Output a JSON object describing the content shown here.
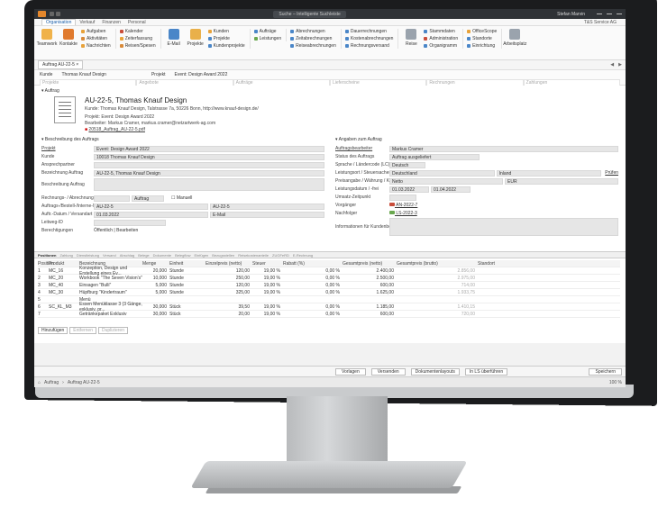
{
  "window": {
    "search": "Suche – Intelligente Suchleiste",
    "user": "Stefan Marvin",
    "company": "T&S Service AG"
  },
  "menu_tabs": [
    "Organisation",
    "Verkauf",
    "Finanzen",
    "Personal"
  ],
  "ribbon": {
    "big1": "Teamwork",
    "big2": "Kontakte",
    "big3": "E-Mail",
    "big4": "Projekte",
    "big5": "Reise",
    "big6": "Arbeitsplatz",
    "g1": [
      "Aufgaben",
      "Aktivitäten",
      "Nachrichten"
    ],
    "g2": [
      "Kalender",
      "Zeiterfassung",
      "Reisen/Spesen"
    ],
    "g3": [
      "Kunden",
      "Projekte",
      "Kundenprojekte"
    ],
    "g4": [
      "Aufträge",
      "Leistungen"
    ],
    "g5": [
      "Abrechnungen",
      "Zeitabrechnungen",
      "Reiseabrechnungen"
    ],
    "g6": [
      "Dauerrechnungen",
      "Kostenabrechnungen",
      "Rechnungsversand"
    ],
    "g7": [
      "Stammdaten",
      "Administration",
      "Organigramm"
    ],
    "g8": [
      "OfficeScope",
      "Standorte",
      "Einrichtung"
    ]
  },
  "nav": {
    "tab": "Auftrag AU-22-5",
    "close": "×",
    "back": "◀",
    "fwd": "▶"
  },
  "filter": {
    "kunde_label": "Kunde",
    "kunde": "Thomas Knauf Design",
    "projekt_label": "Projekt",
    "projekt": "Event: Design Award 2022",
    "cols": [
      "Projekte",
      "Angebote",
      "Aufträge",
      "Lieferscheine",
      "Rechnungen",
      "Zahlungen"
    ]
  },
  "section_auftrag": "Auftrag",
  "header": {
    "title": "AU-22-5, Thomas Knauf Design",
    "kunde": "Kunde: Thomas Knauf Design, Talstrasse 7a, 50226 Bonn, http://www.knauf-design.de/",
    "projekt": "Projekt: Event: Design Award 2022",
    "bearbeiter": "Bearbeiter: Markus Cramer, markus.cramer@netzartwerk-ag.com",
    "file": "20518_Auftrag_AU-22-5.pdf"
  },
  "left": {
    "title": "Beschreibung des Auftrags",
    "fields": [
      {
        "l": "Projekt",
        "v": "Event: Design Award 2022"
      },
      {
        "l": "Kunde",
        "v": "10018 Thomas Knauf Design"
      },
      {
        "l": "Ansprechpartner",
        "v": ""
      },
      {
        "l": "Bezeichnung Auftrag",
        "v": "AU-22-5, Thomas Knauf Design"
      },
      {
        "l": "Beschreibung Auftrag",
        "v": ""
      },
      {
        "l": "Rechnungs- / Abrechnungskreis",
        "v": "Auftrag"
      },
      {
        "l": "Auftrags-/Bestell-/Interne-Nr.",
        "v": "AU-22-5"
      },
      {
        "l": "Auftr.-Datum / Versandart",
        "v": "01.03.2022"
      },
      {
        "l": "Leitweg-ID",
        "v": ""
      },
      {
        "l": "Berechtigungen",
        "v": "Öffentlich | Bearbeiten"
      }
    ],
    "manuell": "Manuell",
    "nr2": "AU-22-5",
    "email": "E-Mail"
  },
  "right": {
    "title": "Angaben zum Auftrag",
    "fields": [
      {
        "l": "Auftragsbearbeiter",
        "v": "Markus Cramer"
      },
      {
        "l": "Status des Auftrags",
        "v": "Auftrag ausgeliefert"
      },
      {
        "l": "Sprache / Ländercode (LC)",
        "v": "Deutsch"
      },
      {
        "l": "Leistungsort / Steuersachen...",
        "v": "Deutschland"
      },
      {
        "l": "Preisangabe / Währung / Kurs",
        "v": "Netto"
      },
      {
        "l": "Leistungsdatum / -frei",
        "v": "01.03.2022"
      },
      {
        "l": "Umsatz-Zeitpunkt",
        "v": ""
      },
      {
        "l": "Vorgänger",
        "v": "AN-2022-7"
      },
      {
        "l": "Nachfolger",
        "v": "LS-2022-3"
      },
      {
        "l": "Informationen für Kundenbel...",
        "v": ""
      }
    ],
    "inland": "Inland",
    "pruefen": "Prüfen",
    "eur": "EUR",
    "date2": "01.04.2022"
  },
  "subtabs": [
    "Positionen",
    "Zahlung",
    "Dienstleistung",
    "Versand",
    "Abschlag",
    "Belege",
    "Dokumente",
    "Belegflow",
    "Einfügen",
    "Bezugsstellen",
    "Reisekostenanteile",
    "ZUGFeRD",
    "E-Rechnung"
  ],
  "table": {
    "headers": [
      "Position",
      "Produkt",
      "Bezeichnung",
      "Menge",
      "Einheit",
      "Einzelpreis (netto)",
      "Steuer",
      "Rabatt (%)",
      "Gesamtpreis (netto)",
      "Gesamtpreis (brutto)",
      "Standort"
    ],
    "rows": [
      [
        "1",
        "MC_16",
        "Konzeption, Design und Erstellung eines Ev...",
        "20,000",
        "Stunde",
        "120,00",
        "19,00 %",
        "0,00 %",
        "2.400,00",
        "2.856,00",
        ""
      ],
      [
        "2",
        "MC_20",
        "Workbook \"The Seven Vision's\"",
        "10,000",
        "Stunde",
        "250,00",
        "19,00 %",
        "0,00 %",
        "2.500,00",
        "2.975,00",
        ""
      ],
      [
        "3",
        "MC_40",
        "Einsagen \"Bulli\"",
        "5,000",
        "Stunde",
        "120,00",
        "19,00 %",
        "0,00 %",
        "600,00",
        "714,00",
        ""
      ],
      [
        "4",
        "MC_30",
        "Hüpfburg \"Kindertraum\"",
        "5,000",
        "Stunde",
        "325,00",
        "19,00 %",
        "0,00 %",
        "1.625,00",
        "1.933,75",
        ""
      ],
      [
        "5",
        "",
        "Menü",
        "",
        "",
        "",
        "",
        "",
        "",
        "",
        ""
      ],
      [
        "6",
        "SC_KL_M3",
        "Essen Menüklasse 3 (3 Gänge, exklusiv, pr...",
        "30,000",
        "Stück",
        "39,50",
        "19,00 %",
        "0,00 %",
        "1.185,00",
        "1.410,15",
        ""
      ],
      [
        "7",
        "",
        "Getränkepaket Exklusiv",
        "30,000",
        "Stück",
        "20,00",
        "19,00 %",
        "0,00 %",
        "600,00",
        "720,00",
        ""
      ]
    ]
  },
  "table_btns": [
    "Hinzufügen",
    "Entfernen",
    "Duplizieren"
  ],
  "footer": {
    "vorlagen": "Vorlagen",
    "versenden": "Versenden",
    "layouts": "Dokumentenlayouts",
    "ls": "In LS überführen",
    "speichern": "Speichern"
  },
  "status": {
    "breadcrumb": "Auftrag",
    "sep": "›",
    "current": "Auftrag AU-22-5",
    "zoom": "100 %"
  }
}
